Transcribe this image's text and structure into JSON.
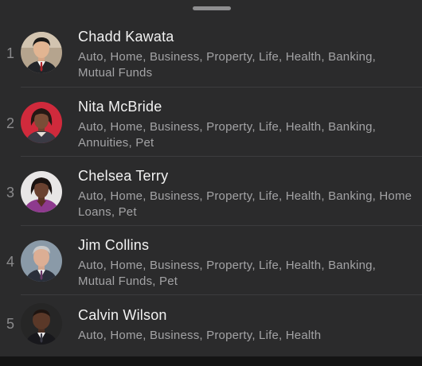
{
  "advisors": [
    {
      "rank": "1",
      "name": "Chadd Kawata",
      "specialties": "Auto, Home, Business, Property, Life, Health, Banking, Mutual Funds"
    },
    {
      "rank": "2",
      "name": "Nita McBride",
      "specialties": "Auto, Home, Business, Property, Life, Health, Banking, Annuities, Pet"
    },
    {
      "rank": "3",
      "name": "Chelsea Terry",
      "specialties": "Auto, Home, Business, Property, Life, Health, Banking, Home Loans, Pet"
    },
    {
      "rank": "4",
      "name": "Jim Collins",
      "specialties": "Auto, Home, Business, Property, Life, Health, Banking, Mutual Funds, Pet"
    },
    {
      "rank": "5",
      "name": "Calvin Wilson",
      "specialties": "Auto, Home, Business, Property, Life, Health"
    }
  ],
  "colors": {
    "sheet_background": "#2b2b2c",
    "name_text": "#f2f2f2",
    "specialty_text": "#a3a3a5",
    "rank_text": "#8a8a8c"
  }
}
